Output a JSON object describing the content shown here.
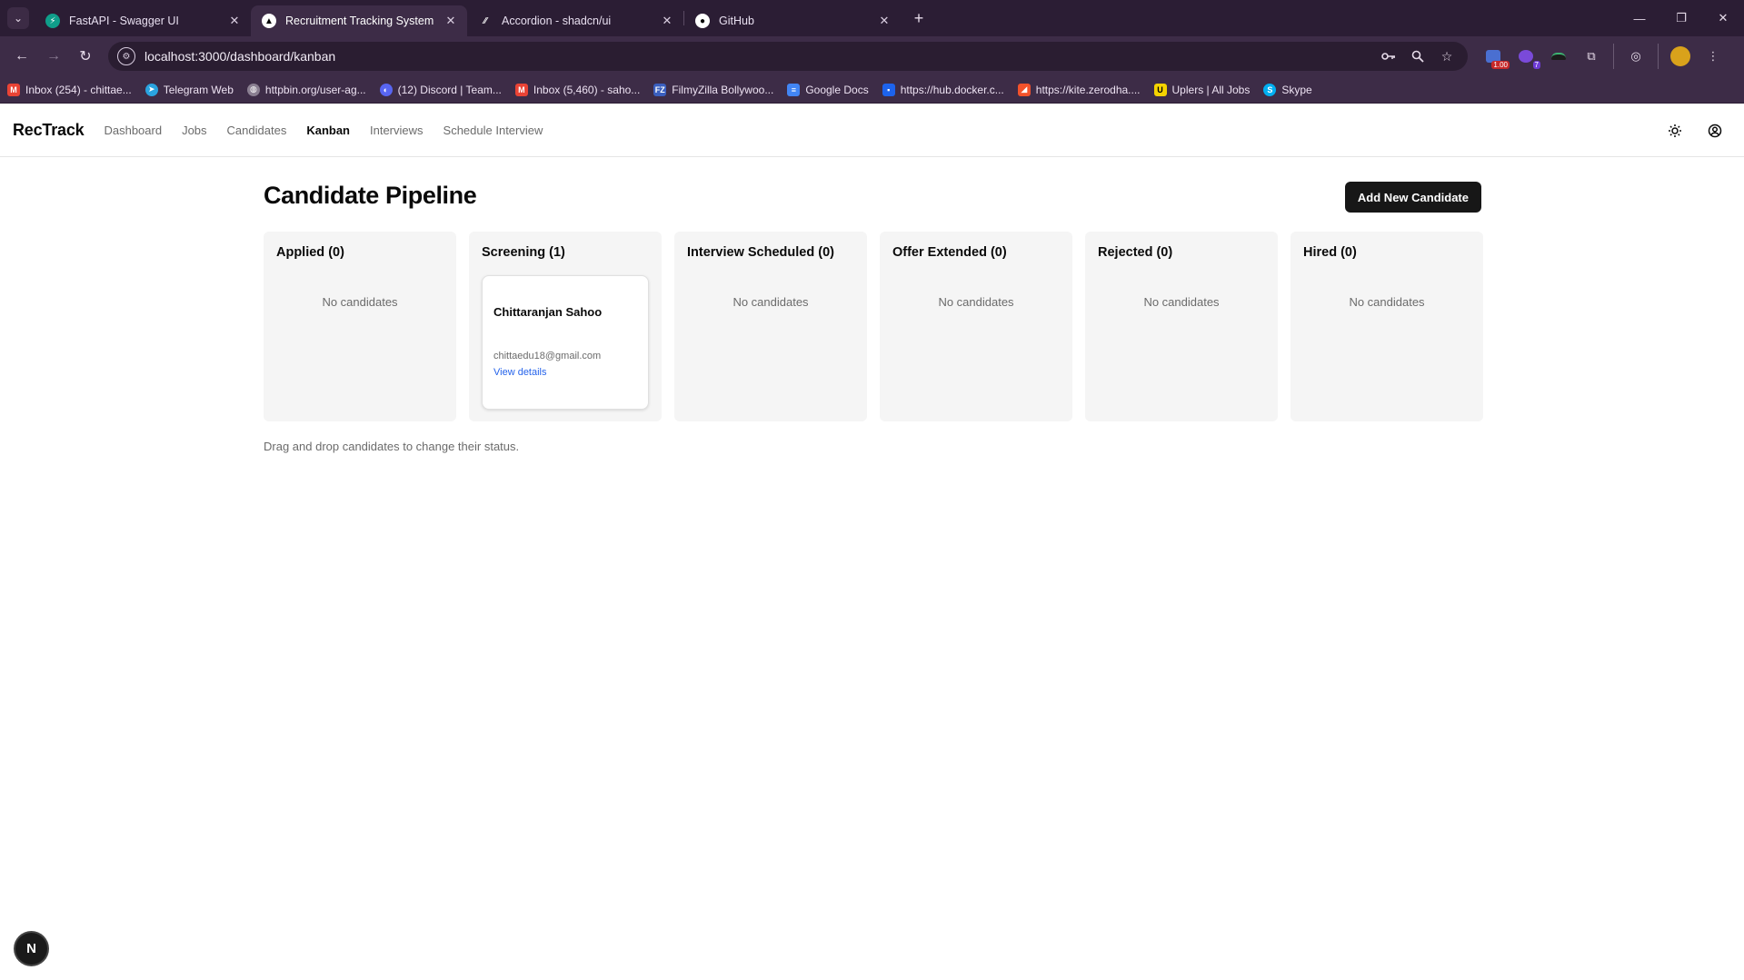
{
  "browser": {
    "tabs": [
      {
        "title": "FastAPI - Swagger UI",
        "icon": "fastapi-icon",
        "active": false
      },
      {
        "title": "Recruitment Tracking System",
        "icon": "nextjs-icon",
        "active": true
      },
      {
        "title": "Accordion - shadcn/ui",
        "icon": "shadcn-icon",
        "active": false
      },
      {
        "title": "GitHub",
        "icon": "github-icon",
        "active": false
      }
    ],
    "url": "localhost:3000/dashboard/kanban",
    "extensions": {
      "badge_1": "1.00",
      "badge_2": "7"
    },
    "bookmarks": [
      {
        "label": "Inbox (254) - chittae...",
        "icon": "gmail-icon"
      },
      {
        "label": "Telegram Web",
        "icon": "telegram-icon"
      },
      {
        "label": "httpbin.org/user-ag...",
        "icon": "globe-icon"
      },
      {
        "label": "(12) Discord | Team...",
        "icon": "discord-icon"
      },
      {
        "label": "Inbox (5,460) - saho...",
        "icon": "gmail-icon"
      },
      {
        "label": "FilmyZilla Bollywoo...",
        "icon": "filmyzilla-icon"
      },
      {
        "label": "Google Docs",
        "icon": "google-docs-icon"
      },
      {
        "label": "https://hub.docker.c...",
        "icon": "docker-icon"
      },
      {
        "label": "https://kite.zerodha....",
        "icon": "kite-icon"
      },
      {
        "label": "Uplers | All Jobs",
        "icon": "uplers-icon"
      },
      {
        "label": "Skype",
        "icon": "skype-icon"
      }
    ]
  },
  "app": {
    "brand": "RecTrack",
    "nav": [
      "Dashboard",
      "Jobs",
      "Candidates",
      "Kanban",
      "Interviews",
      "Schedule Interview"
    ],
    "active_nav": "Kanban"
  },
  "page": {
    "title": "Candidate Pipeline",
    "add_button": "Add New Candidate",
    "columns": [
      {
        "title": "Applied (0)",
        "empty_text": "No candidates"
      },
      {
        "title": "Screening (1)",
        "empty_text": ""
      },
      {
        "title": "Interview Scheduled (0)",
        "empty_text": "No candidates"
      },
      {
        "title": "Offer Extended (0)",
        "empty_text": "No candidates"
      },
      {
        "title": "Rejected (0)",
        "empty_text": "No candidates"
      },
      {
        "title": "Hired (0)",
        "empty_text": "No candidates"
      }
    ],
    "candidate": {
      "name": "Chittaranjan Sahoo",
      "email": "chittaedu18@gmail.com",
      "link": "View details"
    },
    "hint": "Drag and drop candidates to change their status."
  },
  "dev_badge": "N",
  "colors": {
    "chrome_bg": "#2b1d34",
    "toolbar_bg": "#3d2c47",
    "primary_button": "#171717",
    "link": "#2563eb",
    "column_bg": "#f5f5f5"
  }
}
